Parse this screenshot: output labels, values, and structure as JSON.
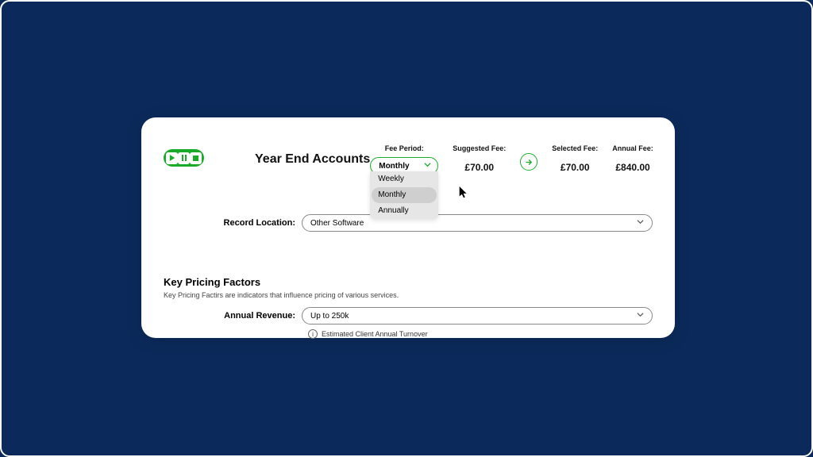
{
  "page_title": "Year End Accounts",
  "header": {
    "fee_period": {
      "label": "Fee Period:",
      "selected": "Monthly",
      "options": [
        "Weekly",
        "Monthly",
        "Annually"
      ]
    },
    "suggested_fee": {
      "label": "Suggested Fee:",
      "value": "£70.00"
    },
    "selected_fee": {
      "label": "Selected Fee:",
      "value": "£70.00"
    },
    "annual_fee": {
      "label": "Annual Fee:",
      "value": "£840.00"
    }
  },
  "record_location": {
    "label": "Record Location:",
    "value": "Other Software"
  },
  "pricing_section": {
    "title": "Key Pricing Factors",
    "subtitle": "Key Pricing Factirs are indicators that influence pricing of various services."
  },
  "annual_revenue": {
    "label": "Annual Revenue:",
    "value": "Up to 250k",
    "hint": "Estimated Client Annual Turnover"
  },
  "colors": {
    "accent": "#1aaa2a"
  }
}
